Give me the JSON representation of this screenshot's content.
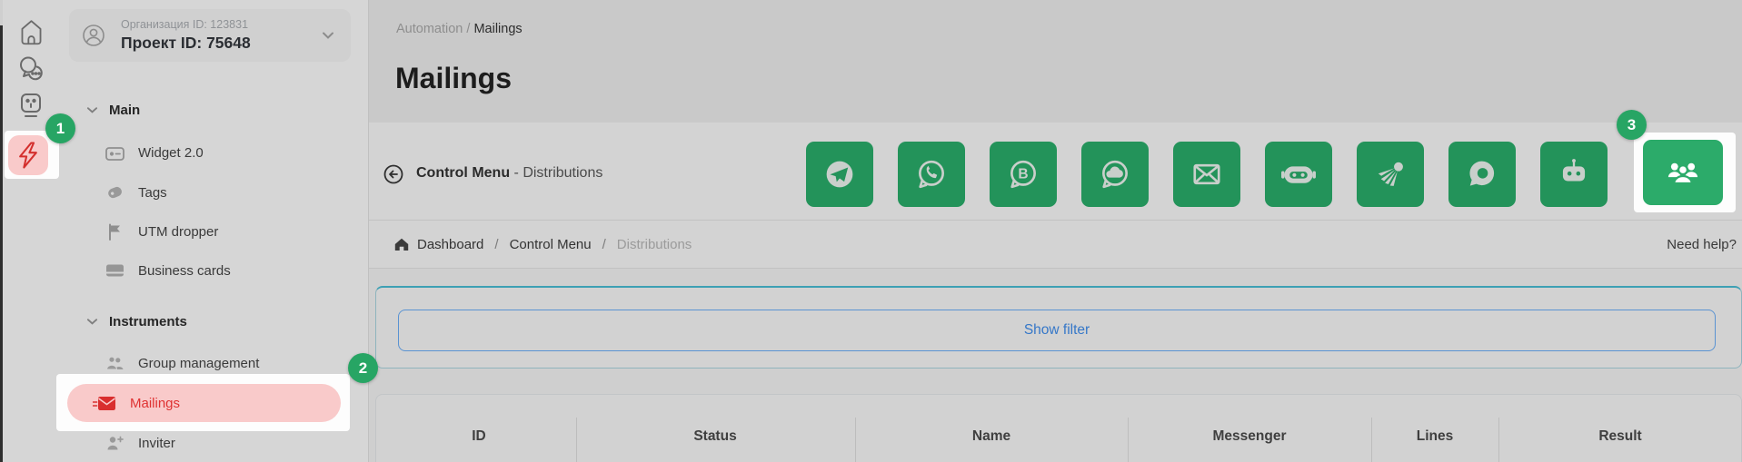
{
  "overlay_badges": {
    "step1": "1",
    "step2": "2",
    "step3": "3"
  },
  "project_selector": {
    "org": "Организация ID: 123831",
    "project": "Проект ID: 75648"
  },
  "menu": {
    "sections": [
      {
        "label": "Main",
        "items": [
          {
            "label": "Widget 2.0"
          },
          {
            "label": "Tags"
          },
          {
            "label": "UTM dropper"
          },
          {
            "label": "Business cards"
          }
        ]
      },
      {
        "label": "Instruments",
        "items": [
          {
            "label": "Group management"
          },
          {
            "label": "Mailings"
          },
          {
            "label": "Inviter"
          }
        ]
      }
    ]
  },
  "page_header": {
    "breadcrumb_parent": "Automation",
    "separator": "/",
    "breadcrumb_current": "Mailings",
    "title": "Mailings"
  },
  "control_menu": {
    "label_main": "Control Menu",
    "label_sub": "- Distributions",
    "channels": [
      "telegram",
      "whatsapp",
      "whatsapp-business",
      "chat-cloud",
      "email",
      "bot-head",
      "shuttlecock",
      "chat-ring",
      "robot",
      "groups"
    ]
  },
  "breadcrumb_bar": {
    "items": [
      "Dashboard",
      "Control Menu",
      "Distributions"
    ],
    "separator": "/",
    "help": "Need help?"
  },
  "filter_panel": {
    "button": "Show filter"
  },
  "table": {
    "headers": [
      "ID",
      "Status",
      "Name",
      "Messenger",
      "Lines",
      "Result"
    ]
  },
  "colors": {
    "green_dim": "#23935a",
    "green_bright": "#2cab6a",
    "badge_green": "#27a564",
    "red": "#d92f2f",
    "pink": "#f9caca",
    "link_blue": "#3577c8",
    "teal": "#3da0b4"
  }
}
